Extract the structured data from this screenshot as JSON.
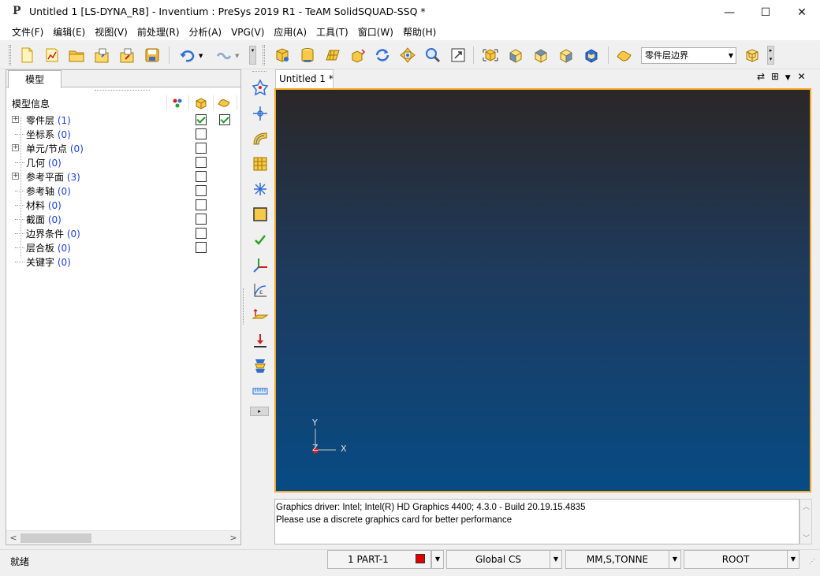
{
  "window": {
    "title": "Untitled 1 [LS-DYNA_R8] - Inventium : PreSys 2019 R1 - TeAM SolidSQUAD-SSQ *",
    "app_icon": "P",
    "controls": {
      "minimize": "—",
      "maximize": "☐",
      "close": "✕"
    }
  },
  "menu": [
    "文件(F)",
    "编辑(E)",
    "视图(V)",
    "前处理(R)",
    "分析(A)",
    "VPG(V)",
    "应用(A)",
    "工具(T)",
    "窗口(W)",
    "帮助(H)"
  ],
  "toolbar": {
    "layer_select_value": "零件层边界",
    "icons": [
      "new-file-icon",
      "open-chart-icon",
      "open-folder-icon",
      "import-icon",
      "export-icon",
      "save-icon",
      "undo-icon",
      "redo-icon",
      "part-icon",
      "cylinder-icon",
      "mesh-icon",
      "move-icon",
      "rotate-icon",
      "pan-icon",
      "zoom-icon",
      "fit-icon",
      "view-iso-icon",
      "view-front-icon",
      "view-top-icon",
      "view-side-icon",
      "view-back-icon",
      "layer-icon",
      "layer-box-icon"
    ]
  },
  "model_panel": {
    "tab_label": "模型",
    "header_label": "模型信息",
    "items": [
      {
        "label": "零件层",
        "count": "(1)",
        "expandable": true,
        "show_checked": true,
        "layer_checked": true,
        "has_checkbox": true
      },
      {
        "label": "坐标系",
        "count": "(0)",
        "expandable": false,
        "show_checked": false,
        "has_checkbox": true
      },
      {
        "label": "单元/节点",
        "count": "(0)",
        "expandable": true,
        "show_checked": false,
        "has_checkbox": true
      },
      {
        "label": "几何",
        "count": "(0)",
        "expandable": false,
        "show_checked": false,
        "has_checkbox": true
      },
      {
        "label": "参考平面",
        "count": "(3)",
        "expandable": true,
        "show_checked": false,
        "has_checkbox": true
      },
      {
        "label": "参考轴",
        "count": "(0)",
        "expandable": false,
        "show_checked": false,
        "has_checkbox": true
      },
      {
        "label": "材料",
        "count": "(0)",
        "expandable": false,
        "show_checked": false,
        "has_checkbox": true
      },
      {
        "label": "截面",
        "count": "(0)",
        "expandable": false,
        "show_checked": false,
        "has_checkbox": true
      },
      {
        "label": "边界条件",
        "count": "(0)",
        "expandable": false,
        "show_checked": false,
        "has_checkbox": true
      },
      {
        "label": "层合板",
        "count": "(0)",
        "expandable": false,
        "show_checked": false,
        "has_checkbox": true
      },
      {
        "label": "关键字",
        "count": "(0)",
        "expandable": false,
        "show_checked": false,
        "has_checkbox": false
      }
    ]
  },
  "document": {
    "tab_label": "Untitled 1 *",
    "axis_labels": {
      "y": "Y",
      "x": "X",
      "z": "Z"
    }
  },
  "console": {
    "lines": [
      "Graphics driver: Intel; Intel(R) HD Graphics 4400; 4.3.0 - Build 20.19.15.4835",
      "Please use a discrete graphics card for better performance"
    ]
  },
  "status": {
    "text": "就绪",
    "part": "1  PART-1",
    "part_color": "#e00000",
    "cs": "Global CS",
    "units": "MM,S,TONNE",
    "level": "ROOT"
  },
  "colors": {
    "viewport_border": "#f5a623",
    "viewport_top": "#2a2727",
    "viewport_bottom": "#074b84",
    "count_text": "#1a3fd6"
  }
}
